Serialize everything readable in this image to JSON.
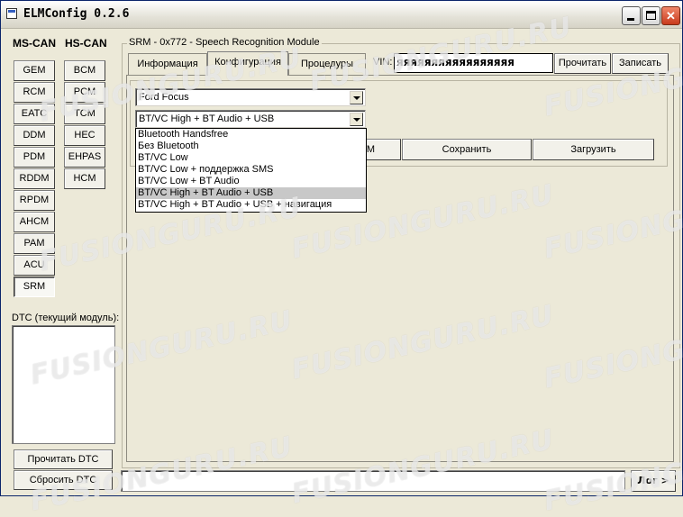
{
  "window": {
    "title": "ELMConfig 0.2.6"
  },
  "ms_can": {
    "label": "MS-CAN",
    "modules": [
      "GEM",
      "RCM",
      "EATC",
      "DDM",
      "PDM",
      "RDDM",
      "RPDM",
      "AHCM",
      "PAM",
      "ACU",
      "SRM"
    ],
    "selected": "SRM"
  },
  "hs_can": {
    "label": "HS-CAN",
    "modules": [
      "BCM",
      "PCM",
      "TCM",
      "HEC",
      "EHPAS",
      "HCM"
    ]
  },
  "dtc": {
    "label": "DTC (текущий модуль):",
    "read_label": "Прочитать DTC",
    "clear_label": "Сбросить DTC"
  },
  "module_group": {
    "label": "SRM - 0x772 - Speech Recognition Module"
  },
  "tabs": [
    "Информация",
    "Конфигурация",
    "Процедуры"
  ],
  "active_tab": "Конфигурация",
  "vin": {
    "label": "VIN:",
    "value": "яяяяяяяяяяяяяяяяя",
    "read_label": "Прочитать",
    "write_label": "Записать"
  },
  "config": {
    "model_value": "Ford Focus",
    "variant_value": "BT/VC High + BT Audio + USB",
    "options": [
      "Bluetooth Handsfree",
      "Без Bluetooth",
      "BT/VC Low",
      "BT/VC Low + поддержка SMS",
      "BT/VC Low + BT Audio",
      "BT/VC High + BT Audio + USB",
      "BT/VC High + BT Audio + USB + навигация"
    ],
    "selected_index": 5,
    "partial_button_label": "М",
    "save_label": "Сохранить",
    "load_label": "Загрузить"
  },
  "log": {
    "value": "",
    "button_label": "Лог >"
  },
  "watermark": "FUSIONGURU.RU"
}
